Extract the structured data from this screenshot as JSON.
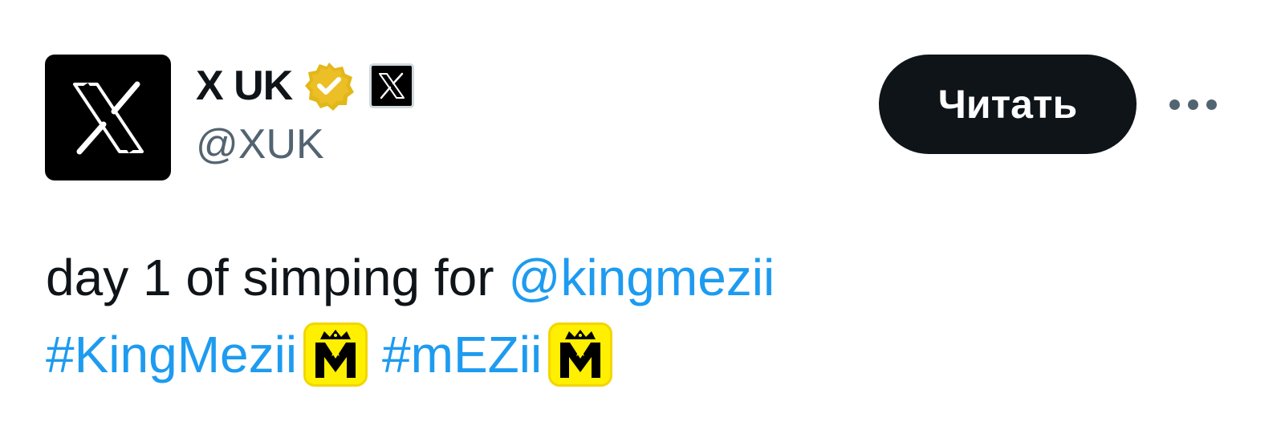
{
  "account": {
    "display_name": "X UK",
    "handle": "@XUK",
    "avatar_icon": "x-logo-icon",
    "verified_icon": "gold-verified-badge-icon",
    "affiliate_icon": "x-affiliate-badge-icon"
  },
  "actions": {
    "follow_label": "Читать",
    "more_icon": "more-dots-icon"
  },
  "tweet": {
    "prefix_text": "day 1 of simping for",
    "mention": "@kingmezii",
    "hashtags": [
      {
        "text": "#KingMezii",
        "hashflag_icon": "king-mezii-hashflag-icon"
      },
      {
        "text": "#mEZii",
        "hashflag_icon": "king-mezii-hashflag-icon"
      }
    ]
  },
  "colors": {
    "text_primary": "#0f1419",
    "text_secondary": "#536471",
    "link": "#1d9bf0",
    "button_bg": "#0f1419",
    "verified_gold": "#e2b719",
    "hashflag_yellow": "#ffef00"
  }
}
